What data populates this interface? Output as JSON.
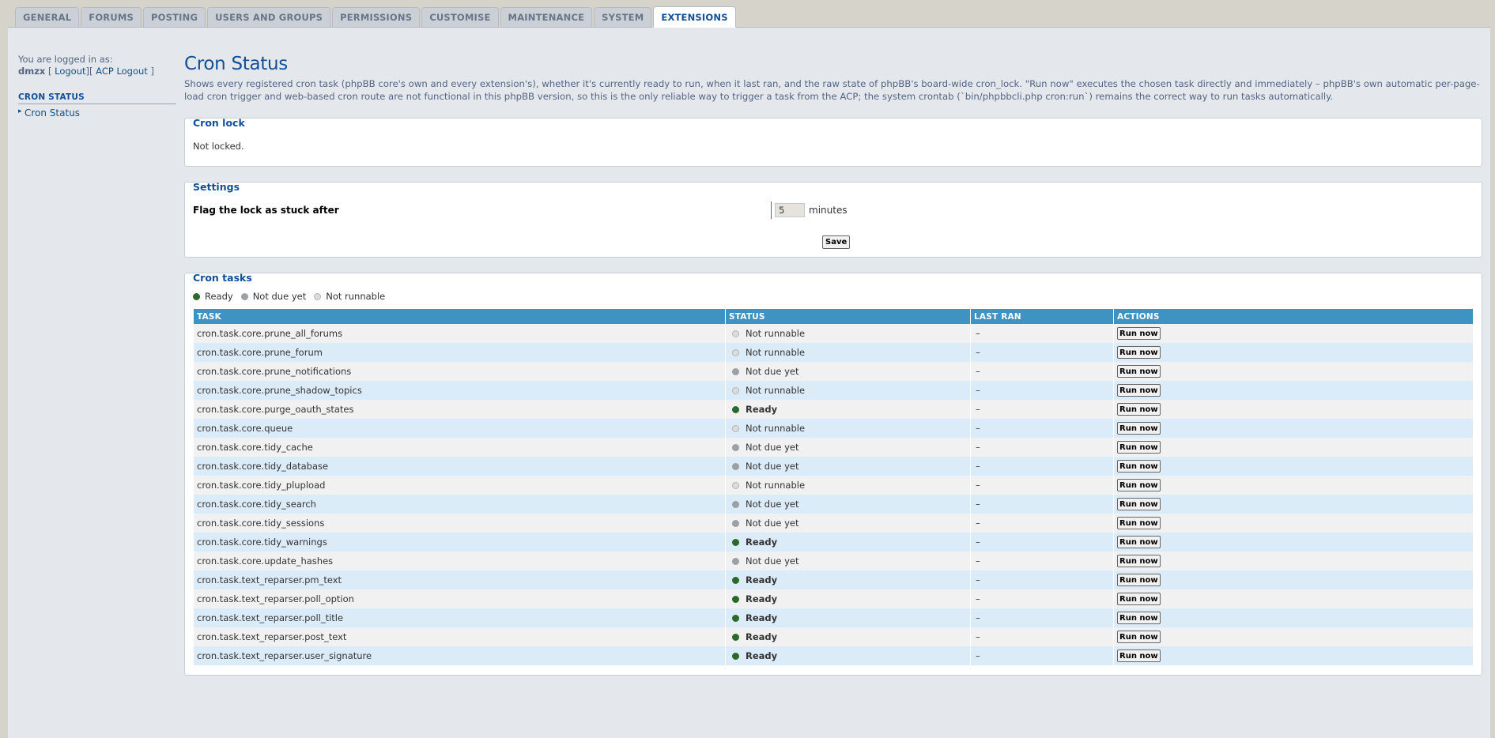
{
  "tabs": [
    {
      "label": "GENERAL",
      "active": false
    },
    {
      "label": "FORUMS",
      "active": false
    },
    {
      "label": "POSTING",
      "active": false
    },
    {
      "label": "USERS AND GROUPS",
      "active": false
    },
    {
      "label": "PERMISSIONS",
      "active": false
    },
    {
      "label": "CUSTOMISE",
      "active": false
    },
    {
      "label": "MAINTENANCE",
      "active": false
    },
    {
      "label": "SYSTEM",
      "active": false
    },
    {
      "label": "EXTENSIONS",
      "active": true
    }
  ],
  "sidebar": {
    "logged_in_label": "You are logged in as:",
    "username": "dmzx",
    "logout_label": "Logout",
    "acp_logout_label": "ACP Logout",
    "section_title": "CRON STATUS",
    "items": [
      {
        "label": "Cron Status"
      }
    ]
  },
  "main": {
    "title": "Cron Status",
    "intro": "Shows every registered cron task (phpBB core's own and every extension's), whether it's currently ready to run, when it last ran, and the raw state of phpBB's board-wide cron_lock. \"Run now\" executes the chosen task directly and immediately – phpBB's own automatic per-page-load cron trigger and web-based cron route are not functional in this phpBB version, so this is the only reliable way to trigger a task from the ACP; the system crontab (`bin/phpbbcli.php cron:run`) remains the correct way to run tasks automatically."
  },
  "cron_lock": {
    "legend": "Cron lock",
    "status_text": "Not locked."
  },
  "settings": {
    "legend": "Settings",
    "label": "Flag the lock as stuck after",
    "value": "5",
    "unit": "minutes",
    "save_label": "Save"
  },
  "tasks": {
    "legend": "Cron tasks",
    "key": {
      "ready": "Ready",
      "not_due": "Not due yet",
      "not_runnable": "Not runnable"
    },
    "columns": {
      "task": "TASK",
      "status": "STATUS",
      "last_ran": "LAST RAN",
      "actions": "ACTIONS"
    },
    "run_label": "Run now",
    "colors": {
      "ready": "#2b6a2b",
      "not_due": "#9aa0a6",
      "not_runnable": "#dcdcdc",
      "header": "#3f93c3",
      "accent": "#115098"
    },
    "rows": [
      {
        "task": "cron.task.core.prune_all_forums",
        "status": "Not runnable",
        "state": "notrun",
        "last_ran": "–"
      },
      {
        "task": "cron.task.core.prune_forum",
        "status": "Not runnable",
        "state": "notrun",
        "last_ran": "–"
      },
      {
        "task": "cron.task.core.prune_notifications",
        "status": "Not due yet",
        "state": "notdue",
        "last_ran": "–"
      },
      {
        "task": "cron.task.core.prune_shadow_topics",
        "status": "Not runnable",
        "state": "notrun",
        "last_ran": "–"
      },
      {
        "task": "cron.task.core.purge_oauth_states",
        "status": "Ready",
        "state": "ready",
        "last_ran": "–"
      },
      {
        "task": "cron.task.core.queue",
        "status": "Not runnable",
        "state": "notrun",
        "last_ran": "–"
      },
      {
        "task": "cron.task.core.tidy_cache",
        "status": "Not due yet",
        "state": "notdue",
        "last_ran": "–"
      },
      {
        "task": "cron.task.core.tidy_database",
        "status": "Not due yet",
        "state": "notdue",
        "last_ran": "–"
      },
      {
        "task": "cron.task.core.tidy_plupload",
        "status": "Not runnable",
        "state": "notrun",
        "last_ran": "–"
      },
      {
        "task": "cron.task.core.tidy_search",
        "status": "Not due yet",
        "state": "notdue",
        "last_ran": "–"
      },
      {
        "task": "cron.task.core.tidy_sessions",
        "status": "Not due yet",
        "state": "notdue",
        "last_ran": "–"
      },
      {
        "task": "cron.task.core.tidy_warnings",
        "status": "Ready",
        "state": "ready",
        "last_ran": "–"
      },
      {
        "task": "cron.task.core.update_hashes",
        "status": "Not due yet",
        "state": "notdue",
        "last_ran": "–"
      },
      {
        "task": "cron.task.text_reparser.pm_text",
        "status": "Ready",
        "state": "ready",
        "last_ran": "–"
      },
      {
        "task": "cron.task.text_reparser.poll_option",
        "status": "Ready",
        "state": "ready",
        "last_ran": "–"
      },
      {
        "task": "cron.task.text_reparser.poll_title",
        "status": "Ready",
        "state": "ready",
        "last_ran": "–"
      },
      {
        "task": "cron.task.text_reparser.post_text",
        "status": "Ready",
        "state": "ready",
        "last_ran": "–"
      },
      {
        "task": "cron.task.text_reparser.user_signature",
        "status": "Ready",
        "state": "ready",
        "last_ran": "–"
      }
    ]
  }
}
